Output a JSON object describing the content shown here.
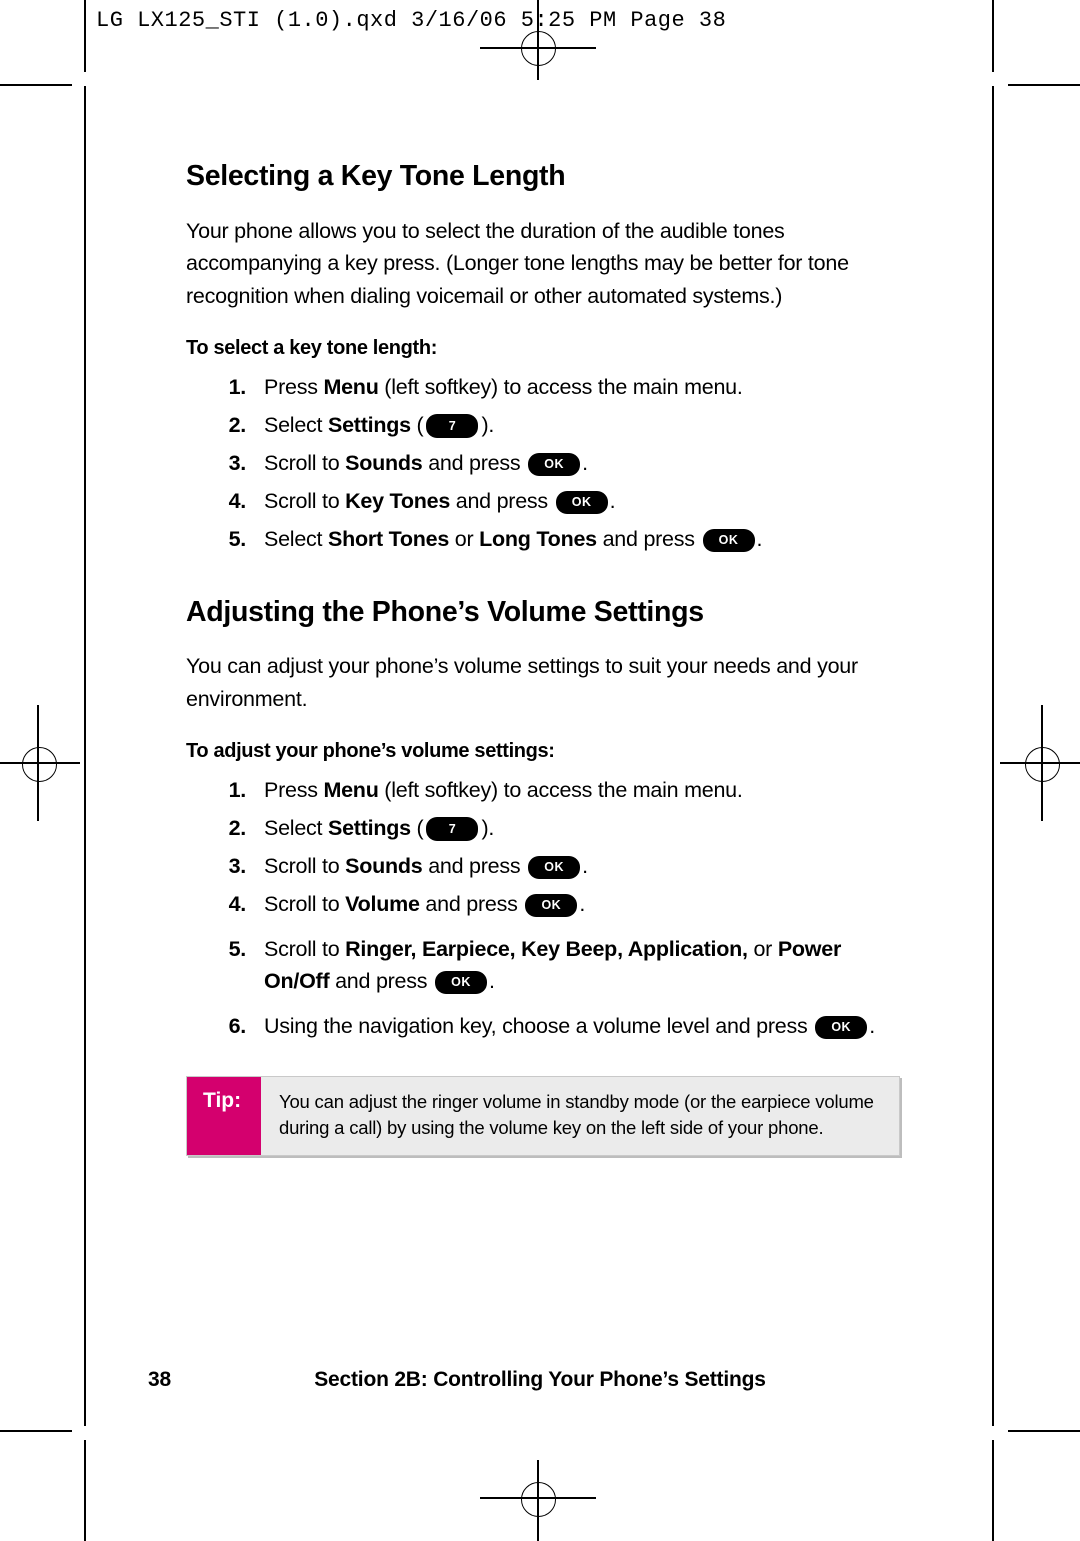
{
  "file_header": "LG LX125_STI (1.0).qxd  3/16/06  5:25 PM  Page 38",
  "sections": [
    {
      "title": "Selecting a Key Tone Length",
      "intro": "Your phone allows you to select the duration of the audible tones accompanying a key press. (Longer tone lengths may be better for tone recognition when dialing voicemail or other automated systems.)",
      "subhead": "To select a key tone length:",
      "steps": [
        {
          "num": "1.",
          "text_before": "Press ",
          "bold1": "Menu",
          "text_after": " (left softkey) to access the main menu.",
          "key": ""
        },
        {
          "num": "2.",
          "text_before": "Select ",
          "bold1": "Settings",
          "text_after": " (",
          "key": "7",
          "text_end": ")."
        },
        {
          "num": "3.",
          "text_before": "Scroll to ",
          "bold1": "Sounds",
          "text_after": " and press ",
          "key": "OK",
          "text_end": "."
        },
        {
          "num": "4.",
          "text_before": "Scroll to ",
          "bold1": "Key Tones",
          "text_after": " and press ",
          "key": "OK",
          "text_end": "."
        },
        {
          "num": "5.",
          "text_before": "Select ",
          "bold1": "Short Tones",
          "mid": " or ",
          "bold2": "Long Tones",
          "text_after": " and press ",
          "key": "OK",
          "text_end": "."
        }
      ]
    },
    {
      "title": "Adjusting the Phone’s Volume Settings",
      "intro": "You can adjust your phone’s volume settings to suit your needs and your environment.",
      "subhead": "To adjust your phone’s volume settings:",
      "steps": [
        {
          "num": "1.",
          "text_before": "Press ",
          "bold1": "Menu",
          "text_after": " (left softkey) to access the main menu.",
          "key": ""
        },
        {
          "num": "2.",
          "text_before": "Select ",
          "bold1": "Settings",
          "text_after": " (",
          "key": "7",
          "text_end": ")."
        },
        {
          "num": "3.",
          "text_before": "Scroll to ",
          "bold1": "Sounds",
          "text_after": " and press ",
          "key": "OK",
          "text_end": "."
        },
        {
          "num": "4.",
          "text_before": "Scroll to ",
          "bold1": "Volume",
          "text_after": " and press ",
          "key": "OK",
          "text_end": "."
        },
        {
          "num": "5.",
          "text_before": "Scroll to ",
          "bold1": "Ringer, Earpiece, Key Beep, Application,",
          "mid": " or ",
          "bold2": "Power On/Off",
          "text_after": " and press ",
          "key": "OK",
          "text_end": "."
        },
        {
          "num": "6.",
          "text_before": "Using the navigation key, choose a volume level and press ",
          "bold1": "",
          "text_after": "",
          "key": "OK",
          "text_end": "."
        }
      ]
    }
  ],
  "tip": {
    "label": "Tip:",
    "body": "You can adjust the ringer volume in standby mode (or the earpiece volume during a call) by using the volume key on the left side of your phone."
  },
  "footer": {
    "page_number": "38",
    "text": "Section 2B: Controlling Your Phone’s Settings"
  },
  "colors": {
    "tip_label_bg": "#d4006e",
    "tip_body_bg": "#ebebeb",
    "key_bg": "#000000"
  }
}
